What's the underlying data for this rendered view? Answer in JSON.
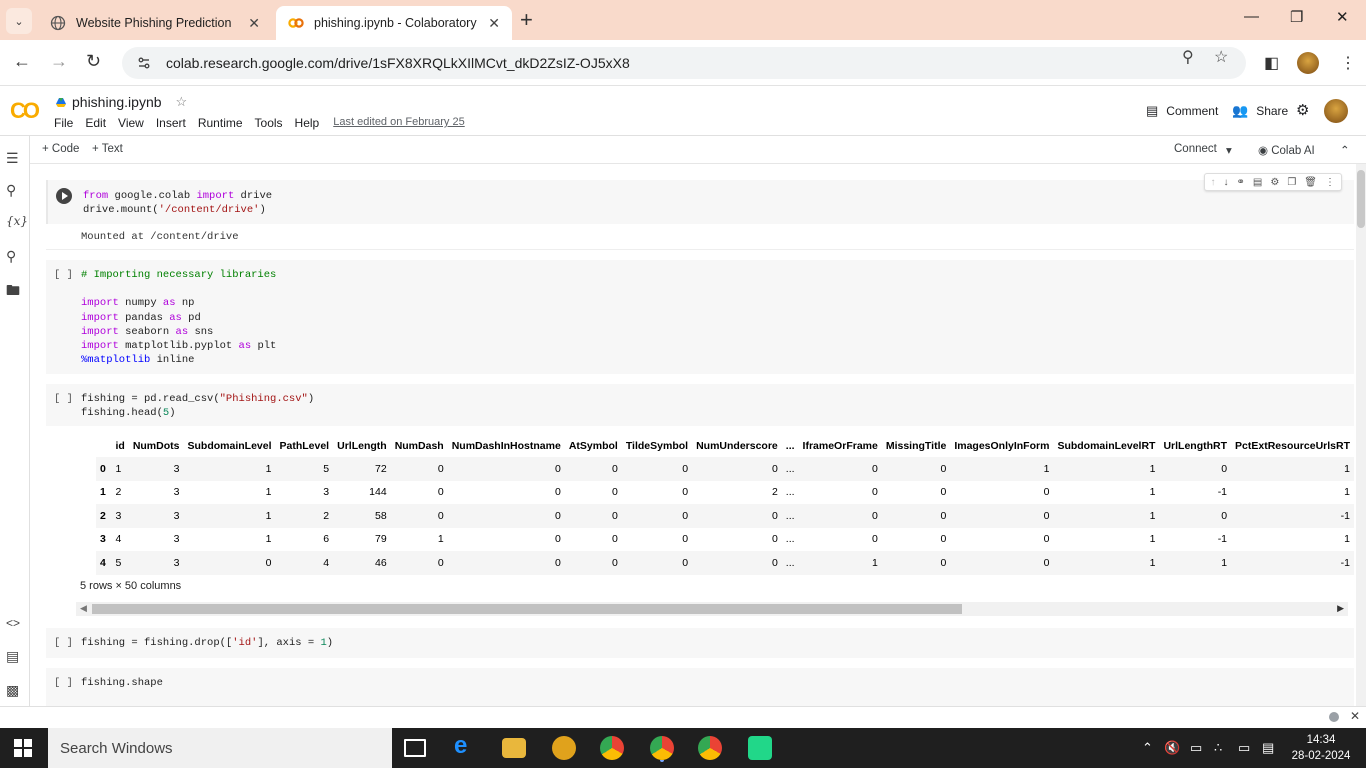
{
  "browser": {
    "tabs": [
      {
        "title": "Website Phishing Prediction",
        "active": false
      },
      {
        "title": "phishing.ipynb - Colaboratory",
        "active": true
      }
    ],
    "url": "colab.research.google.com/drive/1sFX8XRQLkXIlMCvt_dkD2ZsIZ-OJ5xX8"
  },
  "colab": {
    "logo": "CO",
    "notebook_title": "phishing.ipynb",
    "menus": [
      "File",
      "Edit",
      "View",
      "Insert",
      "Runtime",
      "Tools",
      "Help"
    ],
    "last_edited": "Last edited on February 25",
    "comment_label": "Comment",
    "share_label": "Share",
    "toolbar": {
      "add_code": "Code",
      "add_text": "Text",
      "connect": "Connect",
      "colab_ai": "Colab AI"
    }
  },
  "cells": {
    "cell1": {
      "line1": {
        "kw1": "from",
        "mid": " google.colab ",
        "kw2": "import",
        "end": " drive"
      },
      "line2": {
        "pre": "drive.mount(",
        "str": "'/content/drive'",
        "post": ")"
      },
      "output": "Mounted at /content/drive"
    },
    "cell2": {
      "bracket": "[ ]",
      "comment": "# Importing necessary libraries",
      "imports": [
        {
          "kw": "import",
          "mod": " numpy ",
          "as": "as",
          "alias": " np"
        },
        {
          "kw": "import",
          "mod": " pandas ",
          "as": "as",
          "alias": " pd"
        },
        {
          "kw": "import",
          "mod": " seaborn ",
          "as": "as",
          "alias": " sns"
        },
        {
          "kw": "import",
          "mod": " matplotlib.pyplot ",
          "as": "as",
          "alias": " plt"
        }
      ],
      "magic": {
        "kw": "%matplotlib",
        "rest": " inline"
      }
    },
    "cell3": {
      "bracket": "[ ]",
      "line1": {
        "pre": "fishing = pd.read_csv(",
        "str": "\"Phishing.csv\"",
        "post": ")"
      },
      "line2": {
        "pre": "fishing.head(",
        "num": "5",
        "post": ")"
      },
      "table": {
        "columns": [
          "",
          "id",
          "NumDots",
          "SubdomainLevel",
          "PathLevel",
          "UrlLength",
          "NumDash",
          "NumDashInHostname",
          "AtSymbol",
          "TildeSymbol",
          "NumUnderscore",
          "...",
          "IframeOrFrame",
          "MissingTitle",
          "ImagesOnlyInForm",
          "SubdomainLevelRT",
          "UrlLengthRT",
          "PctExtResourceUrlsRT"
        ],
        "rows": [
          [
            "0",
            "1",
            "3",
            "1",
            "5",
            "72",
            "0",
            "0",
            "0",
            "0",
            "0",
            "...",
            "0",
            "0",
            "1",
            "1",
            "0",
            "1"
          ],
          [
            "1",
            "2",
            "3",
            "1",
            "3",
            "144",
            "0",
            "0",
            "0",
            "0",
            "2",
            "...",
            "0",
            "0",
            "0",
            "1",
            "-1",
            "1"
          ],
          [
            "2",
            "3",
            "3",
            "1",
            "2",
            "58",
            "0",
            "0",
            "0",
            "0",
            "0",
            "...",
            "0",
            "0",
            "0",
            "1",
            "0",
            "-1"
          ],
          [
            "3",
            "4",
            "3",
            "1",
            "6",
            "79",
            "1",
            "0",
            "0",
            "0",
            "0",
            "...",
            "0",
            "0",
            "0",
            "1",
            "-1",
            "1"
          ],
          [
            "4",
            "5",
            "3",
            "0",
            "4",
            "46",
            "0",
            "0",
            "0",
            "0",
            "0",
            "...",
            "1",
            "0",
            "0",
            "1",
            "1",
            "-1"
          ]
        ]
      },
      "shape_note": "5 rows × 50 columns"
    },
    "cell4": {
      "bracket": "[ ]",
      "pre": "fishing = fishing.drop([",
      "str": "'id'",
      "mid": "], axis = ",
      "num": "1",
      "post": ")"
    },
    "cell5": {
      "bracket": "[ ]",
      "code": "fishing.shape"
    }
  },
  "taskbar": {
    "search_placeholder": "Search Windows",
    "time": "14:34",
    "date": "28-02-2024"
  },
  "colors": {
    "tabstrip": "#f9dacb",
    "keyword": "#af00db",
    "string": "#a31515",
    "comment": "#008000",
    "colab_orange": "#f9ab00"
  }
}
